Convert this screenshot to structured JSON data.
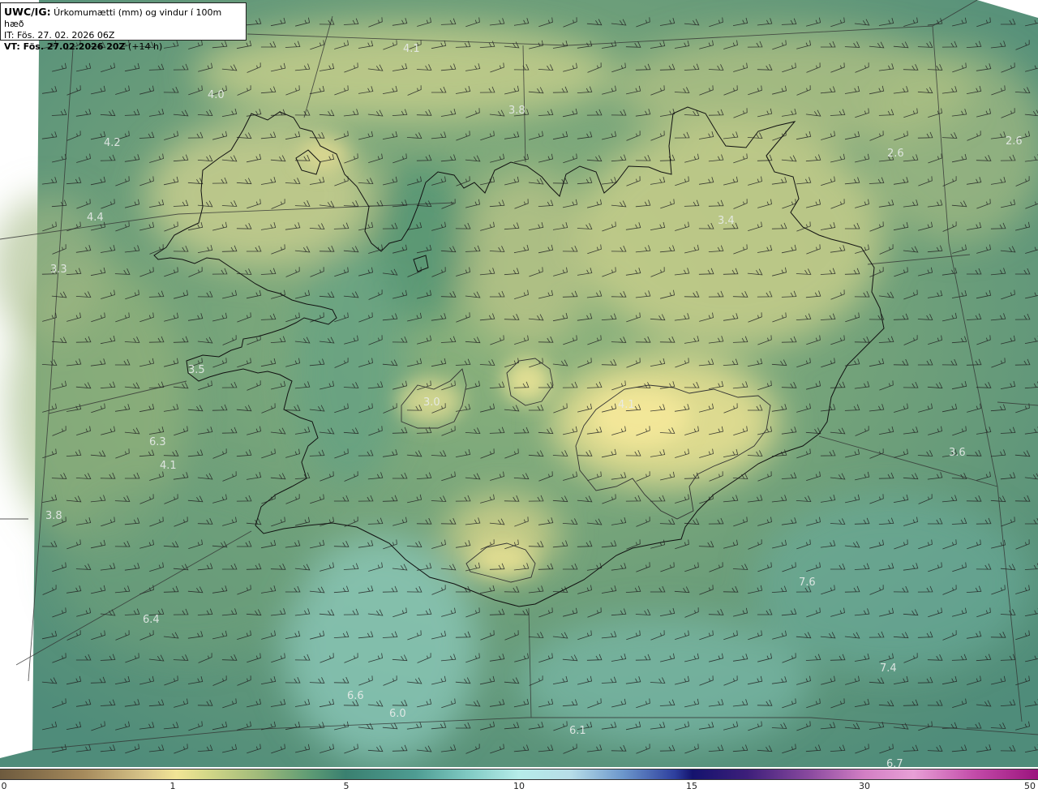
{
  "header": {
    "model": "UWC/IG:",
    "title": "Úrkomumætti (mm) og vindur í 100m hæð",
    "init_time": "IT: Fös. 27. 02. 2026 06Z",
    "valid_prefix": "VT: Fös. 27.02.2026 20Z",
    "valid_suffix": "(+14 h)"
  },
  "value_labels": [
    "4.1",
    "4.0",
    "3.8",
    "4.2",
    "4.4",
    "3.3",
    "2.6",
    "2.6",
    "3.4",
    "4.1",
    "3.0",
    "3.5",
    "6.3",
    "4.1",
    "3.8",
    "3.6",
    "7.6",
    "6.4",
    "7.4",
    "6.6",
    "6.0",
    "6.1",
    "6.7"
  ],
  "colorbar": {
    "ticks": [
      "0",
      "1",
      "5",
      "10",
      "15",
      "30",
      "50"
    ],
    "colors": [
      "#6d5a3e",
      "#f1e596",
      "#3a8070",
      "#b6ece9",
      "#14136e",
      "#d27fc4",
      "#9b137d"
    ]
  }
}
